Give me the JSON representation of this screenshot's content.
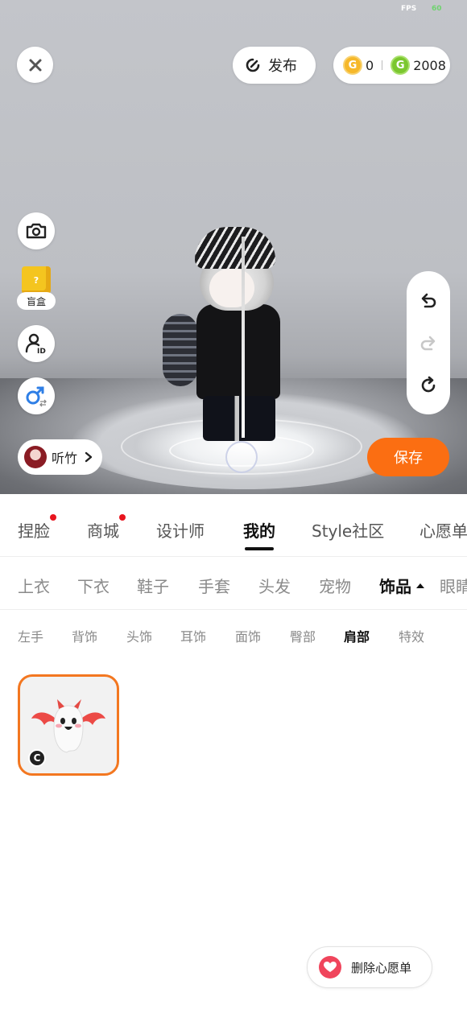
{
  "status": {
    "fps_label": "FPS",
    "fps_value": "60"
  },
  "header": {
    "publish_label": "发布",
    "currency": [
      {
        "icon": "gold-coin-icon",
        "value": "0"
      },
      {
        "icon": "green-coin-icon",
        "value": "2008"
      }
    ]
  },
  "left_tools": {
    "blind_box_label": "盲盒",
    "icons": [
      "close-icon",
      "camera-icon",
      "blind-box-icon",
      "avatar-id-icon",
      "gender-swap-icon"
    ]
  },
  "user": {
    "name": "听竹"
  },
  "right_tools": {
    "icons": [
      "undo-icon",
      "redo-icon",
      "reset-icon"
    ]
  },
  "save_label": "保存",
  "main_tabs": [
    {
      "label": "捏脸"
    },
    {
      "label": "商城"
    },
    {
      "label": "设计师"
    },
    {
      "label": "我的"
    },
    {
      "label": "Style社区"
    },
    {
      "label": "心愿单"
    }
  ],
  "sub_tabs": [
    {
      "label": "上衣"
    },
    {
      "label": "下衣"
    },
    {
      "label": "鞋子"
    },
    {
      "label": "手套"
    },
    {
      "label": "头发"
    },
    {
      "label": "宠物"
    },
    {
      "label": "饰品"
    },
    {
      "label": "眼睛"
    }
  ],
  "category_tabs": [
    {
      "label": "左手"
    },
    {
      "label": "背饰"
    },
    {
      "label": "头饰"
    },
    {
      "label": "耳饰"
    },
    {
      "label": "面饰"
    },
    {
      "label": "臀部"
    },
    {
      "label": "肩部"
    },
    {
      "label": "特效"
    }
  ],
  "items": [
    {
      "icon": "bat-ghost-item-icon",
      "badge": "C"
    }
  ],
  "wishlist_button_label": "删除心愿单",
  "colors": {
    "accent": "#fb6e12",
    "selected_border": "#f37720",
    "heart": "#f0455c",
    "notify_dot": "#e8141e"
  }
}
